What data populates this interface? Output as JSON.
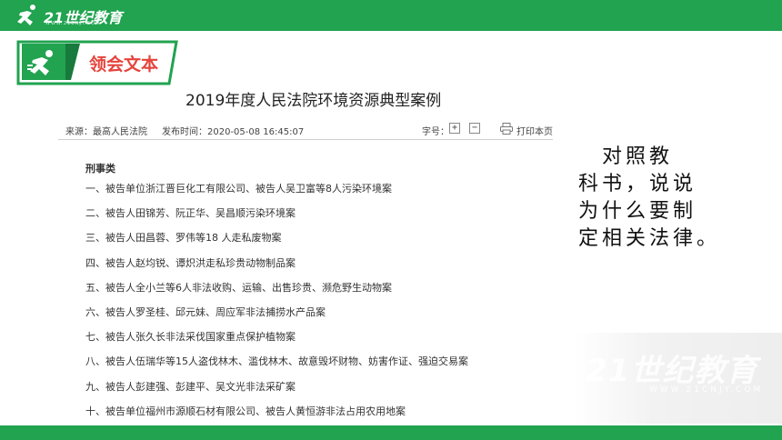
{
  "header": {
    "logo_text": "21世纪教育",
    "logo_sub": "WWW.21CNJY.COM",
    "bar_color": "#21a350"
  },
  "section": {
    "label": "领会文本",
    "label_color": "#e5443c",
    "icon": "runner-icon"
  },
  "document": {
    "title": "2019年度人民法院环境资源典型案例",
    "source": "来源：最高人民法院",
    "publish_time": "发布时间：2020-05-08 16:45:07",
    "font_size_label": "字号：",
    "font_plus": "+",
    "font_minus": "−",
    "print_label": "打印本页",
    "category": "刑事类",
    "cases": [
      "一、被告单位浙江晋巨化工有限公司、被告人吴卫富等8人污染环境案",
      "二、被告人田锦芳、阮正华、吴昌顺污染环境案",
      "三、被告人田昌蓉、罗伟等18 人走私废物案",
      "四、被告人赵均锐、谭炽洪走私珍贵动物制品案",
      "五、被告人全小兰等6人非法收购、运输、出售珍贵、濒危野生动物案",
      "六、被告人罗圣桂、邱元妹、周应军非法捕捞水产品案",
      "七、被告人张久长非法采伐国家重点保护植物案",
      "八、被告人伍瑞华等15人盗伐林木、滥伐林木、故意毁坏财物、妨害作证、强迫交易案",
      "九、被告人彭建强、彭建平、吴文光非法采矿案",
      "十、被告单位福州市源顺石材有限公司、被告人黄恒游非法占用农用地案"
    ]
  },
  "prompt": {
    "lines": [
      "　对照教",
      "科书，说说",
      "为什么要制",
      "定相关法律。"
    ]
  },
  "watermark": {
    "text": "21世纪教育",
    "sub": "WWW.21CNJY.COM"
  }
}
